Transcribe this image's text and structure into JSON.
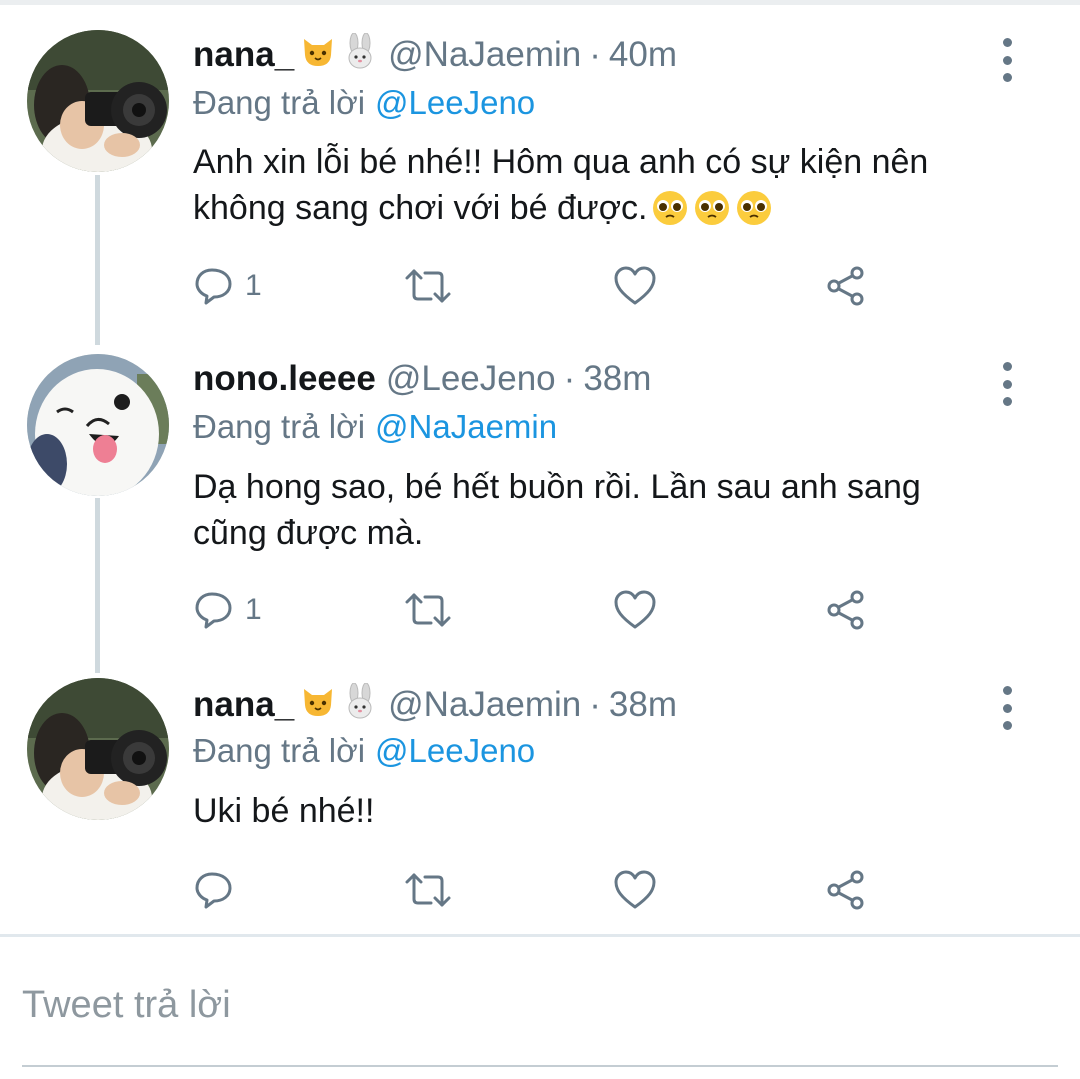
{
  "tweets": [
    {
      "display_name": "nana_",
      "name_emoji": [
        "cat-face",
        "rabbit-face"
      ],
      "handle": "@NaJaemin",
      "time": "40m",
      "separator": "·",
      "reply_prefix": "Đang trả lời",
      "reply_to": "@LeeJeno",
      "text_line1": "Anh xin lỗi bé nhé!! Hôm qua anh có sự kiện nên",
      "text_line2": "không sang chơi với bé được.",
      "text_emoji": [
        "pleading-face",
        "pleading-face",
        "pleading-face"
      ],
      "reply_count": "1",
      "avatar": "camera-photographer"
    },
    {
      "display_name": "nono.leeee",
      "handle": "@LeeJeno",
      "time": "38m",
      "separator": "·",
      "reply_prefix": "Đang trả lời",
      "reply_to": "@NaJaemin",
      "text_line1": "Dạ hong sao, bé hết buồn rồi. Lần sau anh sang",
      "text_line2": "cũng được mà.",
      "reply_count": "1",
      "avatar": "samoyed-dog"
    },
    {
      "display_name": "nana_",
      "name_emoji": [
        "cat-face",
        "rabbit-face"
      ],
      "handle": "@NaJaemin",
      "time": "38m",
      "separator": "·",
      "reply_prefix": "Đang trả lời",
      "reply_to": "@LeeJeno",
      "text_line1": "Uki bé nhé!!",
      "reply_count": "",
      "avatar": "camera-photographer"
    }
  ],
  "reply_composer": {
    "placeholder": "Tweet trả lời"
  },
  "colors": {
    "text": "#14171a",
    "muted": "#657786",
    "link": "#1b95e0",
    "thread_line": "#cfd9de",
    "divider": "#e1e8ed"
  },
  "icons": {
    "reply": "reply-icon",
    "retweet": "retweet-icon",
    "like": "heart-icon",
    "share": "share-icon",
    "more": "more-vertical-icon"
  }
}
